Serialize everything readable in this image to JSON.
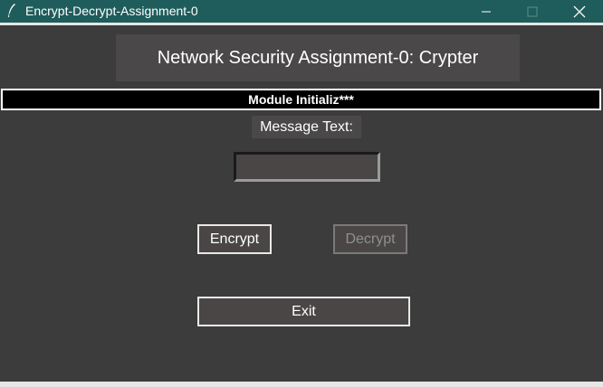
{
  "window": {
    "title": "Encrypt-Decrypt-Assignment-0",
    "controls": {
      "minimize_icon": "minimize-icon",
      "maximize_icon": "maximize-icon",
      "close_icon": "close-icon"
    }
  },
  "header": {
    "title": "Network Security Assignment-0: Crypter"
  },
  "status": {
    "text": "Module Initializ***"
  },
  "form": {
    "message_label": "Message Text:",
    "message_value": ""
  },
  "actions": {
    "encrypt_label": "Encrypt",
    "decrypt_label": "Decrypt",
    "exit_label": "Exit"
  },
  "colors": {
    "titlebar": "#1f5c5c",
    "background": "#3c3c3c",
    "panel": "#4a4848",
    "status_bg": "#000000",
    "text": "#ffffff",
    "disabled_text": "#8f8f8f"
  }
}
